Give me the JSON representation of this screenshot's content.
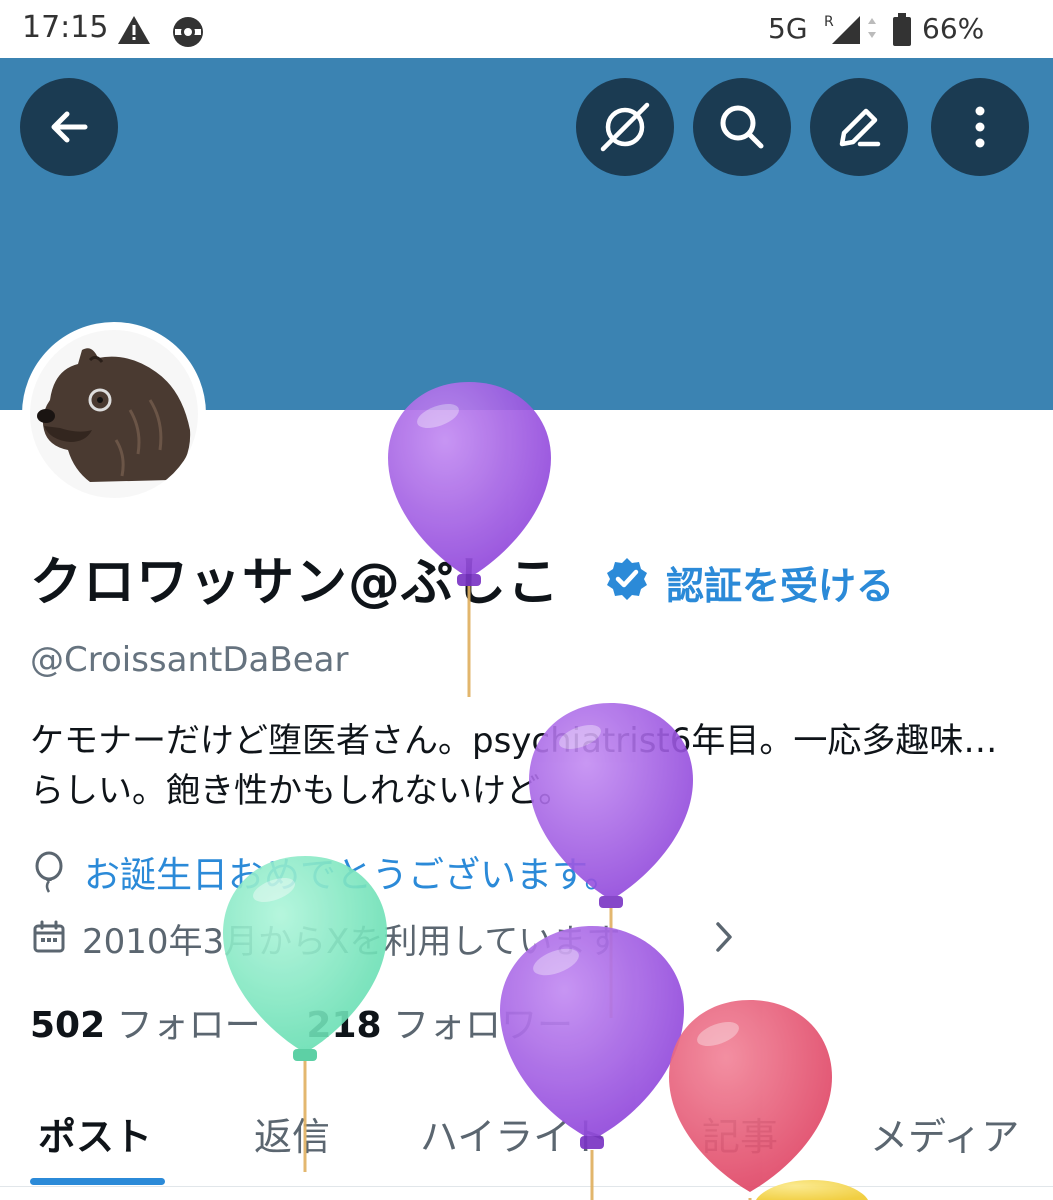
{
  "status_bar": {
    "time": "17:15",
    "network": "5G",
    "roaming": "R",
    "battery": "66%",
    "icons": [
      "warning-icon",
      "sync-icon",
      "signal-icon",
      "battery-icon"
    ]
  },
  "header": {
    "banner_color": "#3b83b2",
    "button_color": "#1b3b52",
    "buttons": [
      "back-arrow-icon",
      "grok-icon",
      "search-icon",
      "compose-icon",
      "more-icon"
    ]
  },
  "profile": {
    "display_name": "クロワッサン@ぷしこ",
    "verify_link": "認証を受ける",
    "handle": "@CroissantDaBear",
    "bio": "ケモナーだけど堕医者さん。psychiatrist6年目。一応多趣味…らしい。飽き性かもしれないけど。",
    "birthday": "お誕生日おめでとうございます。",
    "joined": "2010年3月からXを利用しています",
    "following_count": "502",
    "following_label": "フォロー",
    "followers_count": "218",
    "followers_label": "フォロワー",
    "accent_color": "#2b8ad8"
  },
  "tabs": [
    "ポスト",
    "返信",
    "ハイライト",
    "記事",
    "メディア"
  ],
  "balloon_colors": [
    "#9b4fe0",
    "#7ee8c0",
    "#e8506e",
    "#f5d84a"
  ]
}
